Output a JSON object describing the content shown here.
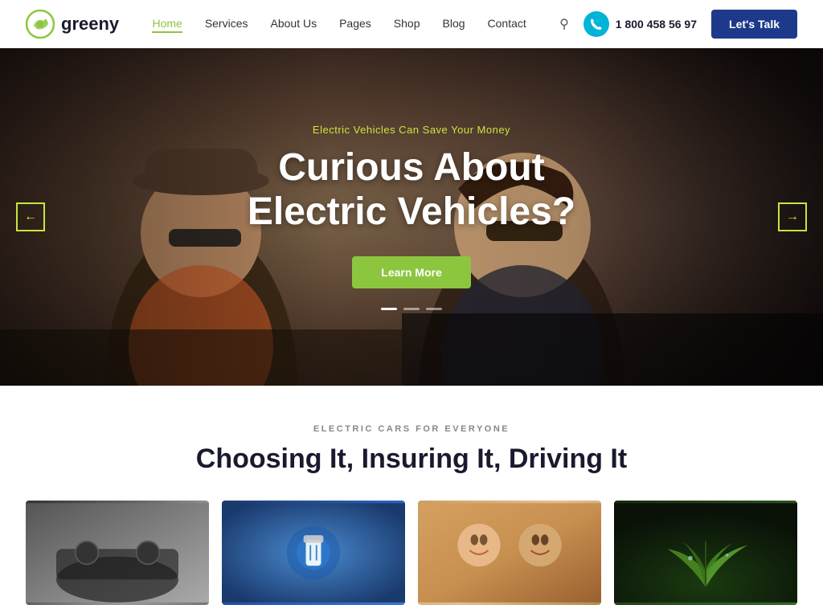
{
  "logo": {
    "text": "greeny",
    "icon_label": "greeny-logo-icon"
  },
  "nav": {
    "links": [
      {
        "label": "Home",
        "active": true
      },
      {
        "label": "Services",
        "active": false
      },
      {
        "label": "About Us",
        "active": false
      },
      {
        "label": "Pages",
        "active": false
      },
      {
        "label": "Shop",
        "active": false
      },
      {
        "label": "Blog",
        "active": false
      },
      {
        "label": "Contact",
        "active": false
      }
    ],
    "phone": "1 800 458 56 97",
    "cta_label": "Let's Talk"
  },
  "hero": {
    "subtitle": "Electric Vehicles Can Save Your Money",
    "title_line1": "Curious About",
    "title_line2": "Electric Vehicles?",
    "button_label": "Learn More",
    "dots": [
      {
        "active": true
      },
      {
        "active": false
      },
      {
        "active": false
      }
    ],
    "prev_arrow": "←",
    "next_arrow": "→"
  },
  "section": {
    "label": "ELECTRIC CARS FOR EVERYONE",
    "title": "Choosing It, Insuring It, Driving It",
    "cards": [
      {
        "id": 1,
        "alt": "Car dashboard"
      },
      {
        "id": 2,
        "alt": "EV charging port"
      },
      {
        "id": 3,
        "alt": "People in car smiling"
      },
      {
        "id": 4,
        "alt": "Green plant"
      }
    ]
  }
}
